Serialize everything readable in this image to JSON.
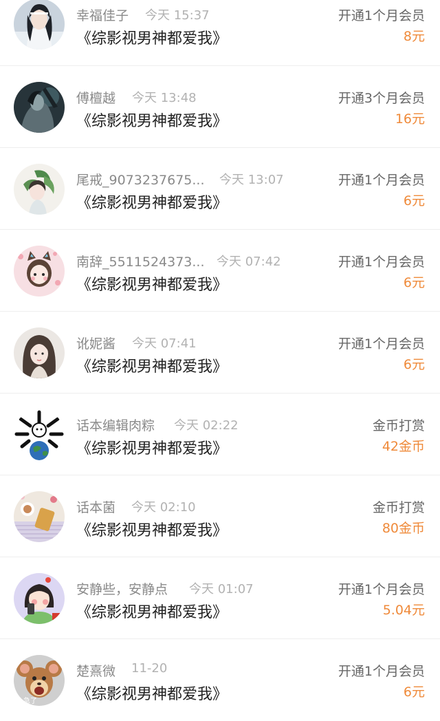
{
  "records": [
    {
      "name": "幸福佳子",
      "time": "今天 15:37",
      "book": "《综影视男神都爱我》",
      "type": "开通1个月会员",
      "amount": "8元",
      "avatar_icon": "anime-male-avatar"
    },
    {
      "name": "傅檀越",
      "time": "今天 13:48",
      "book": "《综影视男神都爱我》",
      "type": "开通3个月会员",
      "amount": "16元",
      "avatar_icon": "dark-fantasy-avatar"
    },
    {
      "name": "尾戒_9073237675...",
      "time": "今天 13:07",
      "book": "《综影视男神都爱我》",
      "type": "开通1个月会员",
      "amount": "6元",
      "avatar_icon": "leaf-girl-avatar"
    },
    {
      "name": "南辞_5511524373...",
      "time": "今天 07:42",
      "book": "《综影视男神都爱我》",
      "type": "开通1个月会员",
      "amount": "6元",
      "avatar_icon": "cat-ear-girl-avatar"
    },
    {
      "name": "讹妮酱",
      "time": "今天 07:41",
      "book": "《综影视男神都爱我》",
      "type": "开通1个月会员",
      "amount": "6元",
      "avatar_icon": "girl-portrait-avatar"
    },
    {
      "name": "话本编辑肉粽",
      "time": "今天 02:22",
      "book": "《综影视男神都爱我》",
      "type": "金币打赏",
      "amount": "42金币",
      "avatar_icon": "earth-bones-avatar"
    },
    {
      "name": "话本菌",
      "time": "今天 02:10",
      "book": "《综影视男神都爱我》",
      "type": "金币打赏",
      "amount": "80金币",
      "avatar_icon": "food-flatlay-avatar"
    },
    {
      "name": "安静些，安静点",
      "time": "今天 01:07",
      "book": "《综影视男神都爱我》",
      "type": "开通1个月会员",
      "amount": "5.04元",
      "avatar_icon": "cartoon-girl-phone-avatar"
    },
    {
      "name": "楚熹微",
      "time": "11-20",
      "book": "《综影视男神都爱我》",
      "type": "开通1个月会员",
      "amount": "6元",
      "avatar_icon": "jerry-mouse-avatar",
      "avatar_caption": "急了"
    }
  ]
}
